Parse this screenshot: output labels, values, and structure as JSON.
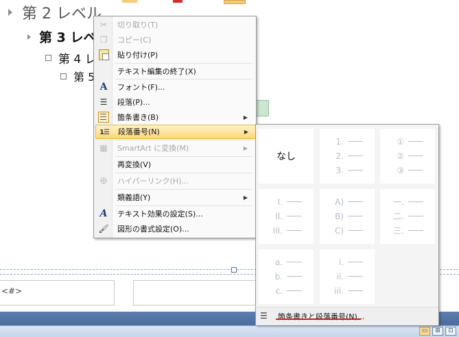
{
  "outline": {
    "level2": "第 2 レベル",
    "level3": "第 3 レベ",
    "level4": "第 4 レ",
    "level5": "第 5"
  },
  "footer": {
    "placeholder": "<#>"
  },
  "context_menu": {
    "items": [
      {
        "label": "切り取り(T)",
        "icon": "scissors-icon",
        "disabled": true
      },
      {
        "label": "コピー(C)",
        "icon": "copy-icon",
        "disabled": true
      },
      {
        "label": "貼り付け(P)",
        "icon": "paste-icon",
        "disabled": false
      },
      {
        "label": "テキスト編集の終了(X)",
        "icon": "",
        "disabled": false
      },
      {
        "label": "フォント(F)...",
        "icon": "font-icon",
        "disabled": false
      },
      {
        "label": "段落(P)...",
        "icon": "paragraph-icon",
        "disabled": false
      },
      {
        "label": "箇条書き(B)",
        "icon": "bullets-icon",
        "disabled": false,
        "submenu": true
      },
      {
        "label": "段落番号(N)",
        "icon": "numbering-icon",
        "disabled": false,
        "submenu": true,
        "highlighted": true
      },
      {
        "label": "SmartArt に変換(M)",
        "icon": "smartart-icon",
        "disabled": true,
        "submenu": true
      },
      {
        "label": "再変換(V)",
        "icon": "",
        "disabled": false
      },
      {
        "label": "ハイパーリンク(H)...",
        "icon": "hyperlink-icon",
        "disabled": true
      },
      {
        "label": "類義語(Y)",
        "icon": "",
        "disabled": false,
        "submenu": true
      },
      {
        "label": "テキスト効果の設定(S)...",
        "icon": "text-effects-icon",
        "disabled": false
      },
      {
        "label": "図形の書式設定(O)...",
        "icon": "shape-format-icon",
        "disabled": false
      }
    ],
    "submenu_arrow": "▶"
  },
  "numbering_gallery": {
    "none_label": "なし",
    "cells": [
      {
        "name": "arabic",
        "markers": [
          "1.",
          "2.",
          "3."
        ]
      },
      {
        "name": "circled",
        "markers": [
          "①",
          "②",
          "③"
        ]
      },
      {
        "name": "upper-roman",
        "markers": [
          "I.",
          "II.",
          "III."
        ]
      },
      {
        "name": "upper-alpha-paren",
        "markers": [
          "A)",
          "B)",
          "C)"
        ]
      },
      {
        "name": "kanji",
        "markers": [
          "一.",
          "二.",
          "三."
        ]
      },
      {
        "name": "lower-alpha",
        "markers": [
          "a.",
          "b.",
          "c."
        ]
      },
      {
        "name": "lower-roman",
        "markers": [
          "i.",
          "ii.",
          "iii."
        ]
      }
    ],
    "footer_label": "箇条書きと段落番号(N)..."
  },
  "statusbar": {
    "view_buttons": [
      {
        "name": "normal-view-button",
        "glyph": "▭",
        "active": true
      },
      {
        "name": "slide-sorter-button",
        "glyph": "⊞",
        "active": false
      },
      {
        "name": "reading-view-button",
        "glyph": "⊡",
        "active": false
      }
    ]
  },
  "colors": {
    "menu_highlight": "#fcd77a",
    "statusbar": "#3a5d91",
    "annotation_red": "#d91717"
  }
}
